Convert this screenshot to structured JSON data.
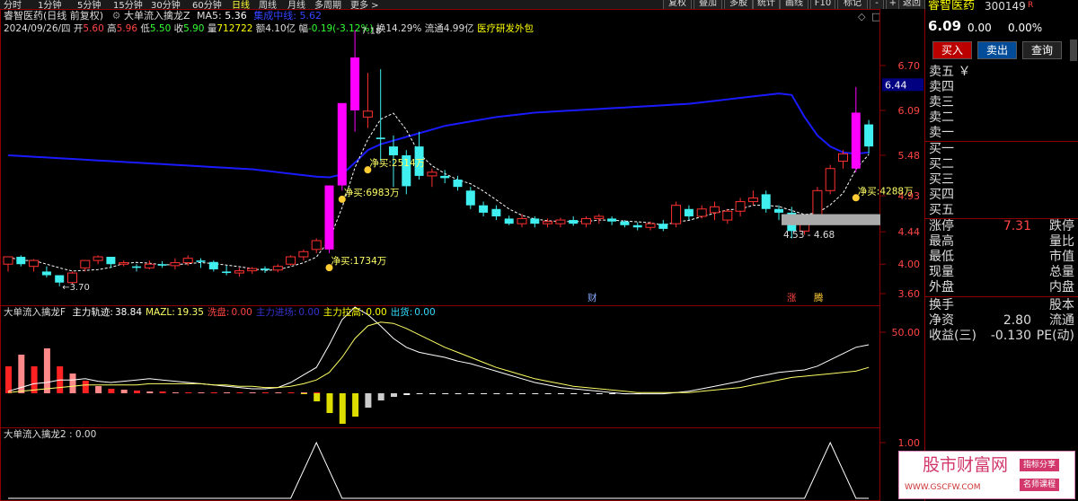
{
  "toolbar": {
    "periods": [
      "分时",
      "1分钟",
      "5分钟",
      "15分钟",
      "30分钟",
      "60分钟",
      "日线",
      "周线",
      "月线",
      "多周期",
      "更多 >"
    ],
    "active_period": "日线",
    "buttons": [
      "复权",
      "叠加",
      "多股",
      "统计",
      "画线",
      "F10",
      "标记",
      "-",
      "+",
      "返回"
    ]
  },
  "header": {
    "title": "睿智医药(日线 前复权)",
    "indicator_name": "大单流入擒龙Z",
    "ma5_label": "MA5:",
    "ma5_value": "5.36",
    "second_label": "集成中线:",
    "second_value": "5.62",
    "date": "2024/09/26/四",
    "open_label": "开",
    "open": "5.60",
    "high_label": "高",
    "high": "5.96",
    "low_label": "低",
    "low": "5.50",
    "close_label": "收",
    "close": "5.90",
    "vol_label": "量",
    "vol": "712722",
    "amt_label": "额",
    "amt": "4.10亿",
    "chg_label": "幅",
    "chg": "-0.19(-3.12%)",
    "turn_label": "换",
    "turn": "14.29%",
    "float_label": "流通",
    "float": "4.99亿",
    "industry": "医疗研发外包"
  },
  "chart_data": {
    "type": "candlestick",
    "yticks": [
      "6.70",
      "6.09",
      "5.48",
      "4.93",
      "4.44",
      "4.00",
      "3.60"
    ],
    "ylim": [
      3.55,
      7.3
    ],
    "current_price_tag": "6.44",
    "candles": [
      [
        4.0,
        4.1,
        3.9,
        4.1
      ],
      [
        4.1,
        4.12,
        3.97,
        4.0
      ],
      [
        3.97,
        4.07,
        3.9,
        4.05
      ],
      [
        3.9,
        3.97,
        3.82,
        3.85
      ],
      [
        3.85,
        3.85,
        3.7,
        3.75
      ],
      [
        3.75,
        3.9,
        3.73,
        3.88
      ],
      [
        3.95,
        4.05,
        3.9,
        4.05
      ],
      [
        4.05,
        4.12,
        4.0,
        4.1
      ],
      [
        4.1,
        4.1,
        3.95,
        4.0
      ],
      [
        4.0,
        4.05,
        3.97,
        4.02
      ],
      [
        3.97,
        4.0,
        3.9,
        3.95
      ],
      [
        3.95,
        4.05,
        3.93,
        4.0
      ],
      [
        4.0,
        4.04,
        3.95,
        3.98
      ],
      [
        3.98,
        4.08,
        3.93,
        4.02
      ],
      [
        4.02,
        4.12,
        3.98,
        4.08
      ],
      [
        4.05,
        4.08,
        3.95,
        4.03
      ],
      [
        4.03,
        4.05,
        3.9,
        3.93
      ],
      [
        3.9,
        3.98,
        3.85,
        3.88
      ],
      [
        3.88,
        3.95,
        3.83,
        3.91
      ],
      [
        3.91,
        3.96,
        3.87,
        3.94
      ],
      [
        3.94,
        3.97,
        3.88,
        3.92
      ],
      [
        3.92,
        4.0,
        3.89,
        3.97
      ],
      [
        4.0,
        4.12,
        3.98,
        4.1
      ],
      [
        4.1,
        4.2,
        4.05,
        4.17
      ],
      [
        4.2,
        4.35,
        4.15,
        4.32
      ],
      [
        4.2,
        5.07,
        4.15,
        5.07
      ],
      [
        5.07,
        6.19,
        5.0,
        6.19
      ],
      [
        6.09,
        7.18,
        5.8,
        6.81
      ],
      [
        6.0,
        6.6,
        5.85,
        6.08
      ],
      [
        5.72,
        6.65,
        5.4,
        5.7
      ],
      [
        5.6,
        5.75,
        5.05,
        5.48
      ],
      [
        5.48,
        5.55,
        4.95,
        5.06
      ],
      [
        5.6,
        5.8,
        5.15,
        5.2
      ],
      [
        5.2,
        5.3,
        5.05,
        5.25
      ],
      [
        5.2,
        5.28,
        5.1,
        5.17
      ],
      [
        5.15,
        5.2,
        5.0,
        5.05
      ],
      [
        5.0,
        5.05,
        4.75,
        4.8
      ],
      [
        4.8,
        4.85,
        4.65,
        4.7
      ],
      [
        4.75,
        4.8,
        4.6,
        4.65
      ],
      [
        4.62,
        4.66,
        4.53,
        4.55
      ],
      [
        4.55,
        4.68,
        4.5,
        4.62
      ],
      [
        4.62,
        4.65,
        4.5,
        4.55
      ],
      [
        4.55,
        4.62,
        4.5,
        4.58
      ],
      [
        4.55,
        4.63,
        4.5,
        4.6
      ],
      [
        4.6,
        4.65,
        4.52,
        4.55
      ],
      [
        4.55,
        4.65,
        4.5,
        4.62
      ],
      [
        4.62,
        4.68,
        4.55,
        4.65
      ],
      [
        4.62,
        4.65,
        4.53,
        4.58
      ],
      [
        4.58,
        4.6,
        4.5,
        4.53
      ],
      [
        4.53,
        4.57,
        4.46,
        4.5
      ],
      [
        4.5,
        4.58,
        4.46,
        4.55
      ],
      [
        4.55,
        4.6,
        4.45,
        4.48
      ],
      [
        4.55,
        4.85,
        4.5,
        4.8
      ],
      [
        4.75,
        4.8,
        4.6,
        4.65
      ],
      [
        4.65,
        4.8,
        4.62,
        4.75
      ],
      [
        4.7,
        4.85,
        4.6,
        4.78
      ],
      [
        4.6,
        4.75,
        4.55,
        4.72
      ],
      [
        4.72,
        4.9,
        4.65,
        4.85
      ],
      [
        4.85,
        5.0,
        4.8,
        4.9
      ],
      [
        4.95,
        5.0,
        4.7,
        4.75
      ],
      [
        4.75,
        4.8,
        4.6,
        4.7
      ],
      [
        4.7,
        4.78,
        4.35,
        4.45
      ],
      [
        4.45,
        4.6,
        4.4,
        4.58
      ],
      [
        4.6,
        5.05,
        4.55,
        5.0
      ],
      [
        5.0,
        5.35,
        4.95,
        5.3
      ],
      [
        5.4,
        5.55,
        5.3,
        5.5
      ],
      [
        5.3,
        6.41,
        5.25,
        6.06
      ],
      [
        5.9,
        5.96,
        5.5,
        5.6
      ]
    ],
    "ma_line": [
      5.48,
      5.47,
      5.46,
      5.45,
      5.44,
      5.43,
      5.42,
      5.41,
      5.4,
      5.39,
      5.38,
      5.37,
      5.36,
      5.35,
      5.34,
      5.33,
      5.32,
      5.31,
      5.3,
      5.29,
      5.27,
      5.25,
      5.23,
      5.21,
      5.19,
      5.18,
      5.22,
      5.38,
      5.55,
      5.63,
      5.68,
      5.73,
      5.78,
      5.83,
      5.88,
      5.91,
      5.94,
      5.97,
      6.0,
      6.02,
      6.04,
      6.06,
      6.07,
      6.08,
      6.09,
      6.1,
      6.11,
      6.12,
      6.13,
      6.14,
      6.15,
      6.16,
      6.17,
      6.18,
      6.2,
      6.22,
      6.24,
      6.26,
      6.28,
      6.3,
      6.32,
      6.3,
      6.0,
      5.75,
      5.6,
      5.52,
      5.5,
      5.52
    ],
    "net_buy_labels": [
      "净买:1734万",
      "净买:6983万",
      "净买:2514万",
      "净买:4288万"
    ],
    "annotation_high": "7.18",
    "annotation_low": "3.70",
    "range_label": "4.53 - 4.68",
    "event_markers": [
      "财",
      "涨",
      "腾"
    ]
  },
  "sub1": {
    "name": "大单流入擒龙F",
    "items": [
      {
        "label": "主力轨迹:",
        "value": "38.84",
        "color": "#ffffff"
      },
      {
        "label": "MAZL:",
        "value": "19.35",
        "color": "#ffff66"
      },
      {
        "label": "洗盘:",
        "value": "0.00",
        "color": "#ff4444"
      },
      {
        "label": "主力进场:",
        "value": "0.00",
        "color": "#3333cc"
      },
      {
        "label": "主力拉高:",
        "value": "0.00",
        "color": "#ffff00"
      },
      {
        "label": "出货:",
        "value": "0.00",
        "color": "#33ddff"
      }
    ],
    "ytick": "50.00"
  },
  "sub2": {
    "name": "大单流入擒龙2",
    "value": ": 0.00",
    "ytick": "1.00"
  },
  "right_panel": {
    "name": "睿智医药",
    "code": "300149",
    "tag": "R",
    "price": "6.09",
    "change": "0.00",
    "pct": "0.00%",
    "buy_button": "买入",
    "sell_button": "卖出",
    "query_button": "查询",
    "sell_levels": [
      "卖五 ￥",
      "卖四",
      "卖三",
      "卖二",
      "卖一"
    ],
    "buy_levels": [
      "买一",
      "买二",
      "买三",
      "买四",
      "买五"
    ],
    "stats": [
      {
        "l": "涨停",
        "v": "7.31",
        "r": "跌停",
        "vcolor": "#ff4444"
      },
      {
        "l": "最高",
        "v": "",
        "r": "量比",
        "vcolor": "#ddd"
      },
      {
        "l": "最低",
        "v": "",
        "r": "市值",
        "vcolor": "#ddd"
      },
      {
        "l": "现量",
        "v": "",
        "r": "总量",
        "vcolor": "#ddd"
      },
      {
        "l": "外盘",
        "v": "",
        "r": "内盘",
        "vcolor": "#ddd"
      },
      {
        "l": "换手",
        "v": "",
        "r": "股本",
        "vcolor": "#ddd"
      },
      {
        "l": "净资",
        "v": "2.80",
        "r": "流通",
        "vcolor": "#ddd"
      },
      {
        "l": "收益(三)",
        "v": "-0.130",
        "r": "PE(动)",
        "vcolor": "#ddd"
      }
    ]
  },
  "watermark": {
    "title": "股市财富网",
    "url": "WWW.GSCFW.COM",
    "tag1": "指标分享",
    "tag2": "名师课程"
  }
}
